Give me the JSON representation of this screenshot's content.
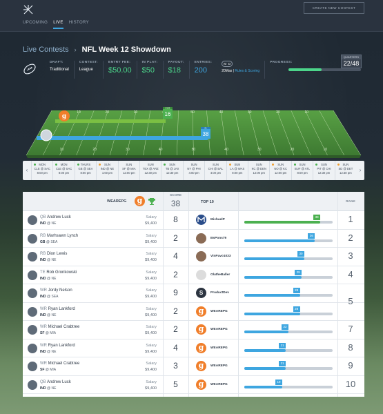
{
  "nav": {
    "items": [
      "UPCOMING",
      "LIVE",
      "HISTORY"
    ],
    "active": "LIVE",
    "create_label": "CREATE NEW CONTEST"
  },
  "breadcrumb": {
    "section": "Live Contests",
    "title": "NFL Week 12 Showdown"
  },
  "contest": {
    "draft_label": "DRAFT:",
    "draft_value": "Traditional",
    "contest_label": "CONTEST:",
    "contest_value": "League",
    "entry_label": "ENTRY FEE:",
    "entry_value": "$50.00",
    "inplay_label": "IN PLAY:",
    "inplay_value": "$50",
    "payout_label": "PAYOUT:",
    "payout_value": "$18",
    "entries_label": "ENTRIES:",
    "entries_value": "200",
    "max_label": "20Max",
    "rules_label": "Rules & Scoring",
    "toggle_m": "M",
    "toggle_d": "D",
    "progress_label": "PROGRESS:",
    "progress_fraction": 0.46,
    "quarters_label": "QUARTERS",
    "quarters_value": "22/48"
  },
  "field": {
    "player1_score": "16",
    "player1_label": "#133",
    "player1_frac": 0.43,
    "player2_score": "38",
    "player2_label": "#1",
    "player2_frac": 0.52,
    "field_numbers": [
      "10",
      "20",
      "30",
      "40",
      "50",
      "40",
      "30",
      "20",
      "10"
    ]
  },
  "schedule": [
    {
      "day": "MON",
      "match": "CLE @ SAC",
      "time": "8:00 pm",
      "status": "#4cb050"
    },
    {
      "day": "MON",
      "match": "CLE @ SAC",
      "time": "8:00 pm",
      "status": "#4cb050"
    },
    {
      "day": "THURS",
      "match": "GB @ SEA",
      "time": "8:00 pm",
      "status": "#4cb050"
    },
    {
      "day": "SUN",
      "match": "IND @ NE",
      "time": "1:00 pm",
      "status": "#f0a030"
    },
    {
      "day": "SUN",
      "match": "SF @ MIA",
      "time": "12:00 pm",
      "status": ""
    },
    {
      "day": "SUN",
      "match": "TEX @ ARZ",
      "time": "12:30 pm",
      "status": ""
    },
    {
      "day": "SUN",
      "match": "TB @ JAX",
      "time": "12:30 pm",
      "status": "#4cb050"
    },
    {
      "day": "SUN",
      "match": "NY @ PHI",
      "time": "4:00 pm",
      "status": ""
    },
    {
      "day": "SUN",
      "match": "CHI @ BAL",
      "time": "4:00 pm",
      "status": ""
    },
    {
      "day": "SUN",
      "match": "LA @ WAS",
      "time": "8:00 pm",
      "status": "#f0a030"
    },
    {
      "day": "SUN",
      "match": "KC @ DEN",
      "time": "12:00 pm",
      "status": ""
    },
    {
      "day": "SUN",
      "match": "NO @ KC",
      "time": "12:00 pm",
      "status": "#f0a030"
    },
    {
      "day": "SUN",
      "match": "BUF @ ATL",
      "time": "8:00 pm",
      "status": "#4cb050"
    },
    {
      "day": "SUN",
      "match": "PIT @ CHI",
      "time": "12:30 pm",
      "status": "#4cb050"
    },
    {
      "day": "SUN",
      "match": "SD @ DET",
      "time": "12:30 pm",
      "status": "#f0a030"
    }
  ],
  "table": {
    "user": "WEAREPG",
    "score_label": "SCORE",
    "score_value": "38",
    "top_label": "TOP 10",
    "rank_label": "RANK",
    "rows": [
      {
        "pos": "QB",
        "name": "Andrew Luck",
        "team": "IND",
        "opp": "@ NE",
        "salary_label": "Salary",
        "salary": "$9,400",
        "score": "8",
        "opponent": "MichaelP",
        "icon": "m",
        "bar": 38,
        "frac": 0.86,
        "color": "#4cb050",
        "rank": "1"
      },
      {
        "pos": "RB",
        "name": "Marhsawn Lynch",
        "team": "GB",
        "opp": "@ SEA",
        "salary_label": "Salary",
        "salary": "$9,400",
        "score": "2",
        "opponent": "BsPons79",
        "icon": "photo",
        "bar": 36,
        "frac": 0.8,
        "color": "#3ea6e0",
        "rank": "2"
      },
      {
        "pos": "RB",
        "name": "Dion Lewis",
        "team": "IND",
        "opp": "@ NE",
        "salary_label": "Salary",
        "salary": "$9,400",
        "score": "4",
        "opponent": "VinPavo1033",
        "icon": "photo",
        "bar": 30,
        "frac": 0.68,
        "color": "#3ea6e0",
        "rank": "3"
      },
      {
        "pos": "TE",
        "name": "Rob Gronkowski",
        "team": "IND",
        "opp": "@ NE",
        "salary_label": "Salary",
        "salary": "$9,400",
        "score": "2",
        "opponent": "OlatheBaller",
        "icon": "dog",
        "bar": 29,
        "frac": 0.65,
        "color": "#3ea6e0",
        "rank": "4"
      },
      {
        "pos": "WR",
        "name": "Jordy Nelson",
        "team": "IND",
        "opp": "@ SEA",
        "salary_label": "Salary",
        "salary": "$9,400",
        "score": "9",
        "opponent": "ProductDev",
        "icon": "s",
        "bar": 28,
        "frac": 0.63,
        "color": "#3ea6e0",
        "rank": "5"
      },
      {
        "pos": "WR",
        "name": "Ryan Lankford",
        "team": "IND",
        "opp": "@ NE",
        "salary_label": "Salary",
        "salary": "$9,400",
        "score": "2",
        "opponent": "WEAREPG",
        "icon": "g",
        "bar": 28,
        "frac": 0.63,
        "color": "#3ea6e0",
        "rank": ""
      },
      {
        "pos": "WR",
        "name": "Michael Crabtree",
        "team": "SF",
        "opp": "@ MIA",
        "salary_label": "Salary",
        "salary": "$9,400",
        "score": "2",
        "opponent": "WEAREPG",
        "icon": "g",
        "bar": 22,
        "frac": 0.5,
        "color": "#3ea6e0",
        "rank": "7"
      },
      {
        "pos": "WR",
        "name": "Ryan Lankford",
        "team": "IND",
        "opp": "@ NE",
        "salary_label": "Salary",
        "salary": "$9,400",
        "score": "4",
        "opponent": "WEAREPG",
        "icon": "g",
        "bar": 21,
        "frac": 0.47,
        "color": "#3ea6e0",
        "rank": "8"
      },
      {
        "pos": "WR",
        "name": "Michael Crabtree",
        "team": "SF",
        "opp": "@ MIA",
        "salary_label": "Salary",
        "salary": "$9,400",
        "score": "3",
        "opponent": "WEAREPG",
        "icon": "g",
        "bar": 21,
        "frac": 0.47,
        "color": "#3ea6e0",
        "rank": "9"
      },
      {
        "pos": "QB",
        "name": "Andrew Luck",
        "team": "IND",
        "opp": "@ NE",
        "salary_label": "Salary",
        "salary": "$9,400",
        "score": "5",
        "opponent": "WEAREPG",
        "icon": "g",
        "bar": 19,
        "frac": 0.43,
        "color": "#3ea6e0",
        "rank": "10"
      }
    ]
  }
}
